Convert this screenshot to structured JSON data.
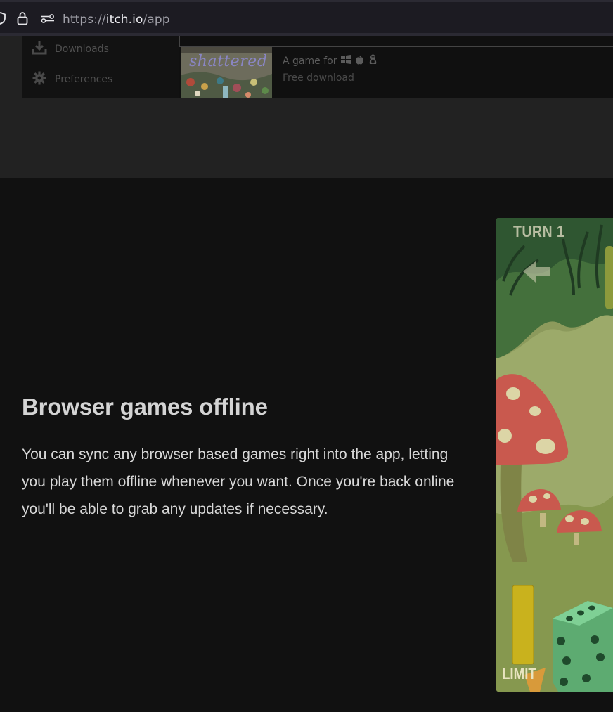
{
  "browser": {
    "url_scheme": "https://",
    "url_host": "itch.io",
    "url_path": "/app"
  },
  "app_preview": {
    "sidebar_items": [
      {
        "label": "Downloads",
        "icon": "download-icon"
      },
      {
        "label": "Preferences",
        "icon": "gear-icon"
      }
    ],
    "game": {
      "thumbnail_title": "shattered",
      "platform_label": "A game for",
      "platform_icons": [
        "windows-icon",
        "apple-icon",
        "linux-icon"
      ],
      "price": "Free download"
    }
  },
  "feature": {
    "heading": "Browser games offline",
    "body": "You can sync any browser based games right into the app, letting you play them offline whenever you want. Once you're back online you'll be able to grab any updates if necessary."
  },
  "game_screenshot": {
    "turn_label": "TURN 1",
    "limit_label": "LIMIT"
  },
  "colors": {
    "page_background": "#111111",
    "top_section_background": "#222222",
    "heading": "#d4d4d4",
    "body_text": "#d8d8d8"
  }
}
